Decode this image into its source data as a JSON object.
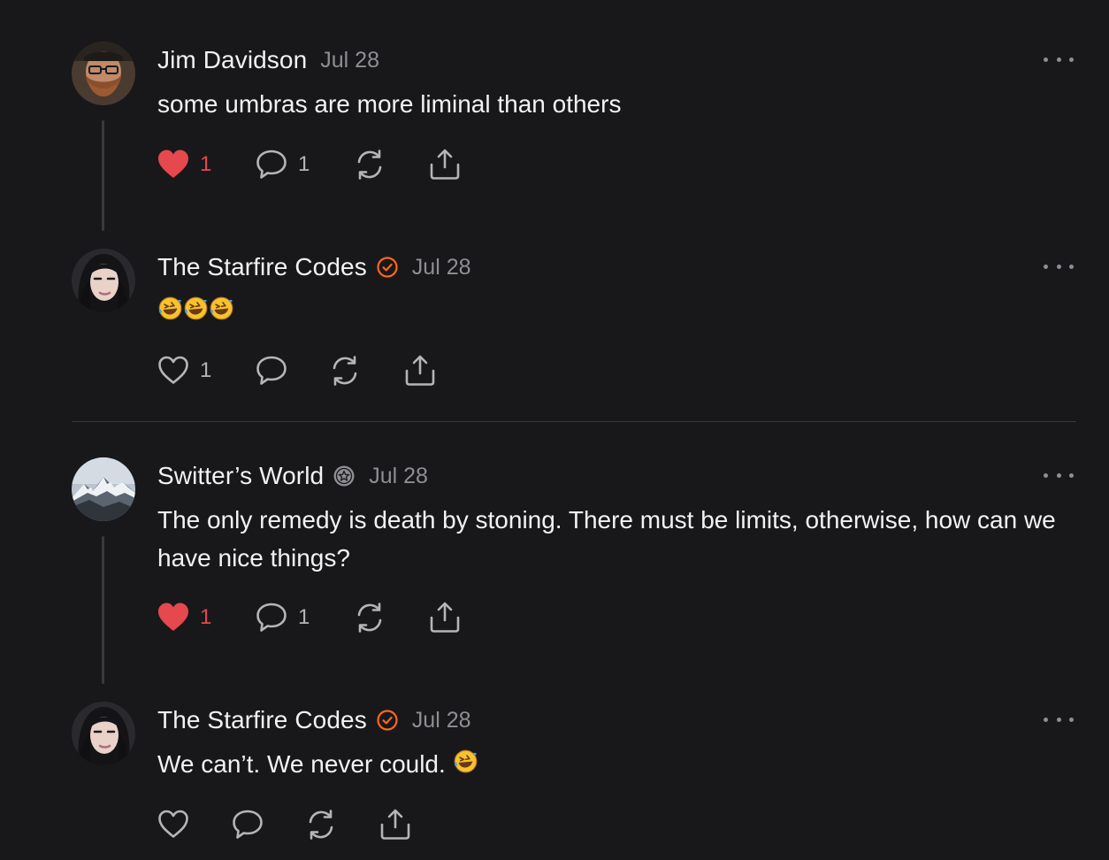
{
  "colors": {
    "background": "#18181a",
    "text": "#f2f2f2",
    "muted": "#8e8e93",
    "like": "#e5484d",
    "verified": "#ff6719",
    "thread_line": "#3a3a3c"
  },
  "comments": [
    {
      "author": "Jim Davidson",
      "date": "Jul 28",
      "badge": null,
      "text": "some umbras are more liminal than others",
      "liked": true,
      "like_count": "1",
      "reply_count": "1"
    },
    {
      "author": "The Starfire Codes",
      "date": "Jul 28",
      "badge": "verified-badge-icon",
      "text": "🤣🤣🤣",
      "liked": false,
      "like_count": "1",
      "reply_count": ""
    },
    {
      "author": "Switter’s World",
      "date": "Jul 28",
      "badge": "star-badge-icon",
      "text": "The only remedy is death by stoning. There must be limits, otherwise, how can we have nice things?",
      "liked": true,
      "like_count": "1",
      "reply_count": "1"
    },
    {
      "author": "The Starfire Codes",
      "date": "Jul 28",
      "badge": "verified-badge-icon",
      "text": "We can’t. We never could. 🤣",
      "liked": false,
      "like_count": "",
      "reply_count": ""
    }
  ],
  "icons": {
    "like": "heart-icon",
    "reply": "comment-bubble-icon",
    "restack": "restack-icon",
    "share": "share-icon",
    "more": "more-options-icon"
  }
}
